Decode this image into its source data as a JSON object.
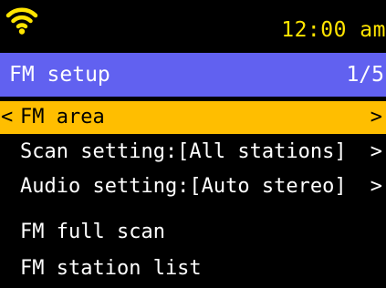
{
  "colors": {
    "background": "#000000",
    "title_bar": "#6161F0",
    "selection": "#FFBE00",
    "clock_text": "#FFE400",
    "wifi_icon": "#FFE400",
    "text": "#FFFFFF"
  },
  "status_bar": {
    "wifi_icon": "wifi-icon",
    "time": "12:00 am"
  },
  "title_bar": {
    "title": "FM setup",
    "page": "1/5"
  },
  "menu": {
    "back_symbol": "<",
    "chevron_symbol": ">",
    "items": [
      {
        "label": "FM area",
        "selected": true,
        "has_chevron": true
      },
      {
        "label": "Scan setting:[All stations]",
        "selected": false,
        "has_chevron": true
      },
      {
        "label": "Audio setting:[Auto stereo]",
        "selected": false,
        "has_chevron": true
      },
      {
        "label": "FM full scan",
        "selected": false,
        "has_chevron": false
      },
      {
        "label": "FM station list",
        "selected": false,
        "has_chevron": false
      }
    ]
  }
}
